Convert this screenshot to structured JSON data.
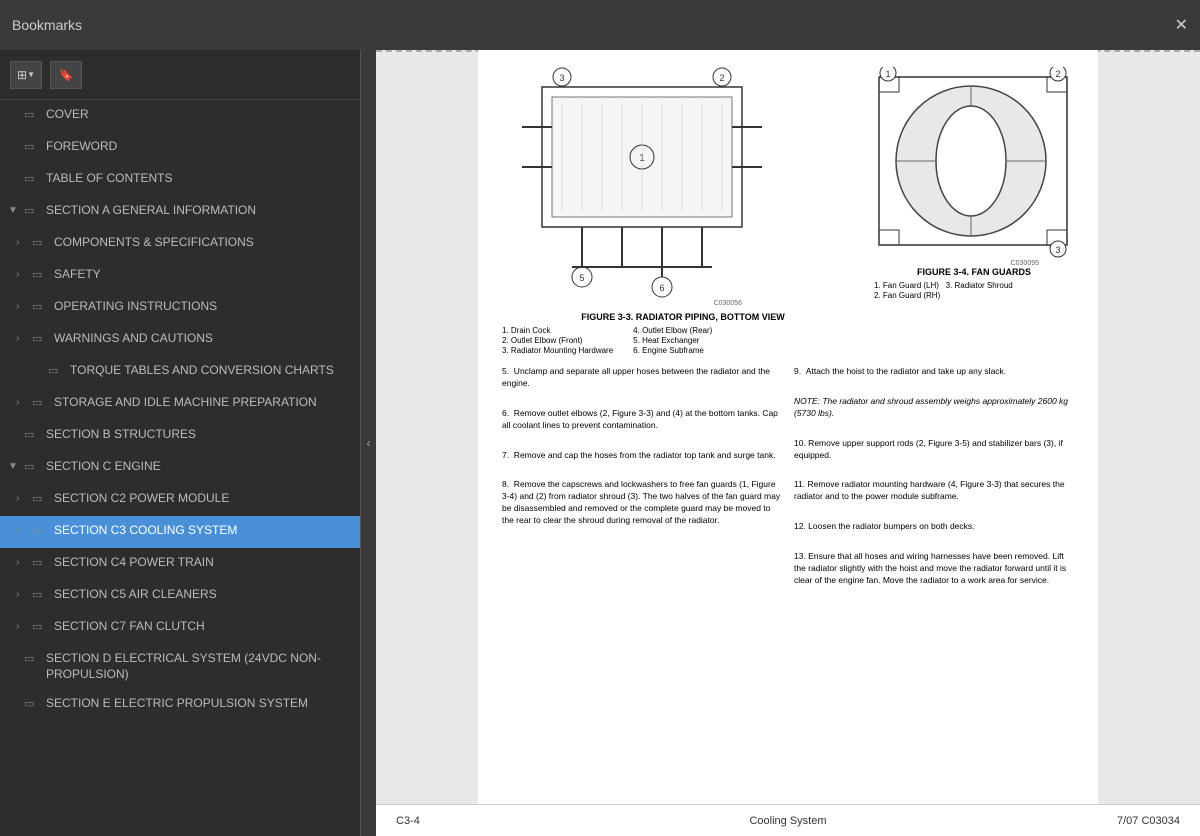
{
  "topbar": {
    "title": "Bookmarks",
    "close_label": "✕"
  },
  "toolbar": {
    "btn1_icon": "⊞",
    "btn2_icon": "🔖"
  },
  "sidebar": {
    "items": [
      {
        "id": "cover",
        "label": "COVER",
        "level": 0,
        "chevron": "",
        "active": false
      },
      {
        "id": "foreword",
        "label": "FOREWORD",
        "level": 0,
        "chevron": "",
        "active": false
      },
      {
        "id": "toc",
        "label": "TABLE OF CONTENTS",
        "level": 0,
        "chevron": "",
        "active": false
      },
      {
        "id": "sec-a",
        "label": "SECTION A GENERAL INFORMATION",
        "level": 0,
        "chevron": "▼",
        "active": false
      },
      {
        "id": "comp-spec",
        "label": "COMPONENTS & SPECIFICATIONS",
        "level": 1,
        "chevron": "›",
        "active": false
      },
      {
        "id": "safety",
        "label": "SAFETY",
        "level": 1,
        "chevron": "›",
        "active": false
      },
      {
        "id": "operating",
        "label": "OPERATING INSTRUCTIONS",
        "level": 1,
        "chevron": "›",
        "active": false
      },
      {
        "id": "warnings",
        "label": "WARNINGS AND CAUTIONS",
        "level": 1,
        "chevron": "›",
        "active": false
      },
      {
        "id": "torque",
        "label": "TORQUE TABLES AND CONVERSION CHARTS",
        "level": 2,
        "chevron": "",
        "active": false
      },
      {
        "id": "storage",
        "label": "STORAGE AND IDLE MACHINE PREPARATION",
        "level": 1,
        "chevron": "›",
        "active": false
      },
      {
        "id": "sec-b",
        "label": "SECTION B STRUCTURES",
        "level": 0,
        "chevron": "",
        "active": false
      },
      {
        "id": "sec-c",
        "label": "SECTION C ENGINE",
        "level": 0,
        "chevron": "▼",
        "active": false
      },
      {
        "id": "sec-c2",
        "label": "SECTION C2 POWER MODULE",
        "level": 1,
        "chevron": "›",
        "active": false
      },
      {
        "id": "sec-c3",
        "label": "SECTION C3 COOLING SYSTEM",
        "level": 1,
        "chevron": "›",
        "active": true
      },
      {
        "id": "sec-c4",
        "label": "SECTION C4 POWER TRAIN",
        "level": 1,
        "chevron": "›",
        "active": false
      },
      {
        "id": "sec-c5",
        "label": "SECTION C5 AIR CLEANERS",
        "level": 1,
        "chevron": "›",
        "active": false
      },
      {
        "id": "sec-c7",
        "label": "SECTION C7 FAN CLUTCH",
        "level": 1,
        "chevron": "›",
        "active": false
      },
      {
        "id": "sec-d",
        "label": "SECTION D ELECTRICAL SYSTEM (24VDC NON-PROPULSION)",
        "level": 0,
        "chevron": "",
        "active": false
      },
      {
        "id": "sec-e",
        "label": "SECTION E ELECTRIC PROPULSION SYSTEM",
        "level": 0,
        "chevron": "",
        "active": false
      }
    ]
  },
  "footer": {
    "left": "C3-4",
    "center": "Cooling System",
    "right": "7/07  C03034"
  },
  "diagrams": {
    "fig3_caption": "FIGURE 3-3. RADIATOR PIPING, BOTTOM VIEW",
    "fig3_labels": [
      "1. Drain Cock",
      "2. Outlet Elbow (Front)",
      "3. Radiator Mounting Hardware",
      "4. Outlet Elbow (Rear)",
      "5. Heat Exchanger",
      "6. Engine Subframe"
    ],
    "fig4_caption": "FIGURE 3-4. FAN GUARDS",
    "fig4_labels": [
      "1. Fan Guard (LH)     3. Radiator Shroud",
      "2. Fan Guard (RH)"
    ]
  },
  "steps_col1": [
    "5. Unclamp and separate all upper hoses between the radiator and the engine.",
    "6. Remove outlet elbows (2, Figure 3-3) and (4) at the bottom tanks. Cap all coolant lines to prevent contamination.",
    "7. Remove and cap the hoses from the radiator top tank and surge tank.",
    "8. Remove the capscrews and lockwashers to free fan guards (1, Figure 3-4) and (2) from radiator shroud (3). The two halves of the fan guard may be disassembled and removed or the complete guard may be moved to the rear to clear the shroud during removal of the radiator."
  ],
  "steps_col2": [
    "9. Attach the hoist to the radiator and take up any slack.",
    "NOTE: The radiator and shroud assembly weighs approximately 2600 kg (5730 lbs).",
    "10. Remove upper support rods (2, Figure 3-5) and stabilizer bars (3), if equipped.",
    "11. Remove radiator mounting hardware (4, Figure 3-3) that secures the radiator and to the power module subframe.",
    "12. Loosen the radiator bumpers on both decks.",
    "13. Ensure that all hoses and wiring harnesses have been removed. Lift the radiator slightly with the hoist and move the radiator forward until it is clear of the engine fan. Move the radiator to a work area for service."
  ]
}
